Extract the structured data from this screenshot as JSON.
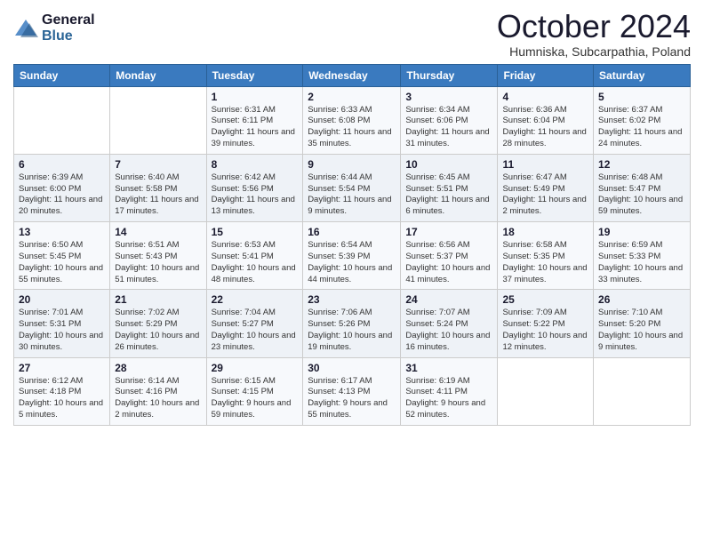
{
  "header": {
    "logo": {
      "general": "General",
      "blue": "Blue"
    },
    "title": "October 2024",
    "location": "Humniska, Subcarpathia, Poland"
  },
  "weekdays": [
    "Sunday",
    "Monday",
    "Tuesday",
    "Wednesday",
    "Thursday",
    "Friday",
    "Saturday"
  ],
  "weeks": [
    [
      {
        "day": "",
        "sunrise": "",
        "sunset": "",
        "daylight": ""
      },
      {
        "day": "",
        "sunrise": "",
        "sunset": "",
        "daylight": ""
      },
      {
        "day": "1",
        "sunrise": "Sunrise: 6:31 AM",
        "sunset": "Sunset: 6:11 PM",
        "daylight": "Daylight: 11 hours and 39 minutes."
      },
      {
        "day": "2",
        "sunrise": "Sunrise: 6:33 AM",
        "sunset": "Sunset: 6:08 PM",
        "daylight": "Daylight: 11 hours and 35 minutes."
      },
      {
        "day": "3",
        "sunrise": "Sunrise: 6:34 AM",
        "sunset": "Sunset: 6:06 PM",
        "daylight": "Daylight: 11 hours and 31 minutes."
      },
      {
        "day": "4",
        "sunrise": "Sunrise: 6:36 AM",
        "sunset": "Sunset: 6:04 PM",
        "daylight": "Daylight: 11 hours and 28 minutes."
      },
      {
        "day": "5",
        "sunrise": "Sunrise: 6:37 AM",
        "sunset": "Sunset: 6:02 PM",
        "daylight": "Daylight: 11 hours and 24 minutes."
      }
    ],
    [
      {
        "day": "6",
        "sunrise": "Sunrise: 6:39 AM",
        "sunset": "Sunset: 6:00 PM",
        "daylight": "Daylight: 11 hours and 20 minutes."
      },
      {
        "day": "7",
        "sunrise": "Sunrise: 6:40 AM",
        "sunset": "Sunset: 5:58 PM",
        "daylight": "Daylight: 11 hours and 17 minutes."
      },
      {
        "day": "8",
        "sunrise": "Sunrise: 6:42 AM",
        "sunset": "Sunset: 5:56 PM",
        "daylight": "Daylight: 11 hours and 13 minutes."
      },
      {
        "day": "9",
        "sunrise": "Sunrise: 6:44 AM",
        "sunset": "Sunset: 5:54 PM",
        "daylight": "Daylight: 11 hours and 9 minutes."
      },
      {
        "day": "10",
        "sunrise": "Sunrise: 6:45 AM",
        "sunset": "Sunset: 5:51 PM",
        "daylight": "Daylight: 11 hours and 6 minutes."
      },
      {
        "day": "11",
        "sunrise": "Sunrise: 6:47 AM",
        "sunset": "Sunset: 5:49 PM",
        "daylight": "Daylight: 11 hours and 2 minutes."
      },
      {
        "day": "12",
        "sunrise": "Sunrise: 6:48 AM",
        "sunset": "Sunset: 5:47 PM",
        "daylight": "Daylight: 10 hours and 59 minutes."
      }
    ],
    [
      {
        "day": "13",
        "sunrise": "Sunrise: 6:50 AM",
        "sunset": "Sunset: 5:45 PM",
        "daylight": "Daylight: 10 hours and 55 minutes."
      },
      {
        "day": "14",
        "sunrise": "Sunrise: 6:51 AM",
        "sunset": "Sunset: 5:43 PM",
        "daylight": "Daylight: 10 hours and 51 minutes."
      },
      {
        "day": "15",
        "sunrise": "Sunrise: 6:53 AM",
        "sunset": "Sunset: 5:41 PM",
        "daylight": "Daylight: 10 hours and 48 minutes."
      },
      {
        "day": "16",
        "sunrise": "Sunrise: 6:54 AM",
        "sunset": "Sunset: 5:39 PM",
        "daylight": "Daylight: 10 hours and 44 minutes."
      },
      {
        "day": "17",
        "sunrise": "Sunrise: 6:56 AM",
        "sunset": "Sunset: 5:37 PM",
        "daylight": "Daylight: 10 hours and 41 minutes."
      },
      {
        "day": "18",
        "sunrise": "Sunrise: 6:58 AM",
        "sunset": "Sunset: 5:35 PM",
        "daylight": "Daylight: 10 hours and 37 minutes."
      },
      {
        "day": "19",
        "sunrise": "Sunrise: 6:59 AM",
        "sunset": "Sunset: 5:33 PM",
        "daylight": "Daylight: 10 hours and 33 minutes."
      }
    ],
    [
      {
        "day": "20",
        "sunrise": "Sunrise: 7:01 AM",
        "sunset": "Sunset: 5:31 PM",
        "daylight": "Daylight: 10 hours and 30 minutes."
      },
      {
        "day": "21",
        "sunrise": "Sunrise: 7:02 AM",
        "sunset": "Sunset: 5:29 PM",
        "daylight": "Daylight: 10 hours and 26 minutes."
      },
      {
        "day": "22",
        "sunrise": "Sunrise: 7:04 AM",
        "sunset": "Sunset: 5:27 PM",
        "daylight": "Daylight: 10 hours and 23 minutes."
      },
      {
        "day": "23",
        "sunrise": "Sunrise: 7:06 AM",
        "sunset": "Sunset: 5:26 PM",
        "daylight": "Daylight: 10 hours and 19 minutes."
      },
      {
        "day": "24",
        "sunrise": "Sunrise: 7:07 AM",
        "sunset": "Sunset: 5:24 PM",
        "daylight": "Daylight: 10 hours and 16 minutes."
      },
      {
        "day": "25",
        "sunrise": "Sunrise: 7:09 AM",
        "sunset": "Sunset: 5:22 PM",
        "daylight": "Daylight: 10 hours and 12 minutes."
      },
      {
        "day": "26",
        "sunrise": "Sunrise: 7:10 AM",
        "sunset": "Sunset: 5:20 PM",
        "daylight": "Daylight: 10 hours and 9 minutes."
      }
    ],
    [
      {
        "day": "27",
        "sunrise": "Sunrise: 6:12 AM",
        "sunset": "Sunset: 4:18 PM",
        "daylight": "Daylight: 10 hours and 5 minutes."
      },
      {
        "day": "28",
        "sunrise": "Sunrise: 6:14 AM",
        "sunset": "Sunset: 4:16 PM",
        "daylight": "Daylight: 10 hours and 2 minutes."
      },
      {
        "day": "29",
        "sunrise": "Sunrise: 6:15 AM",
        "sunset": "Sunset: 4:15 PM",
        "daylight": "Daylight: 9 hours and 59 minutes."
      },
      {
        "day": "30",
        "sunrise": "Sunrise: 6:17 AM",
        "sunset": "Sunset: 4:13 PM",
        "daylight": "Daylight: 9 hours and 55 minutes."
      },
      {
        "day": "31",
        "sunrise": "Sunrise: 6:19 AM",
        "sunset": "Sunset: 4:11 PM",
        "daylight": "Daylight: 9 hours and 52 minutes."
      },
      {
        "day": "",
        "sunrise": "",
        "sunset": "",
        "daylight": ""
      },
      {
        "day": "",
        "sunrise": "",
        "sunset": "",
        "daylight": ""
      }
    ]
  ]
}
